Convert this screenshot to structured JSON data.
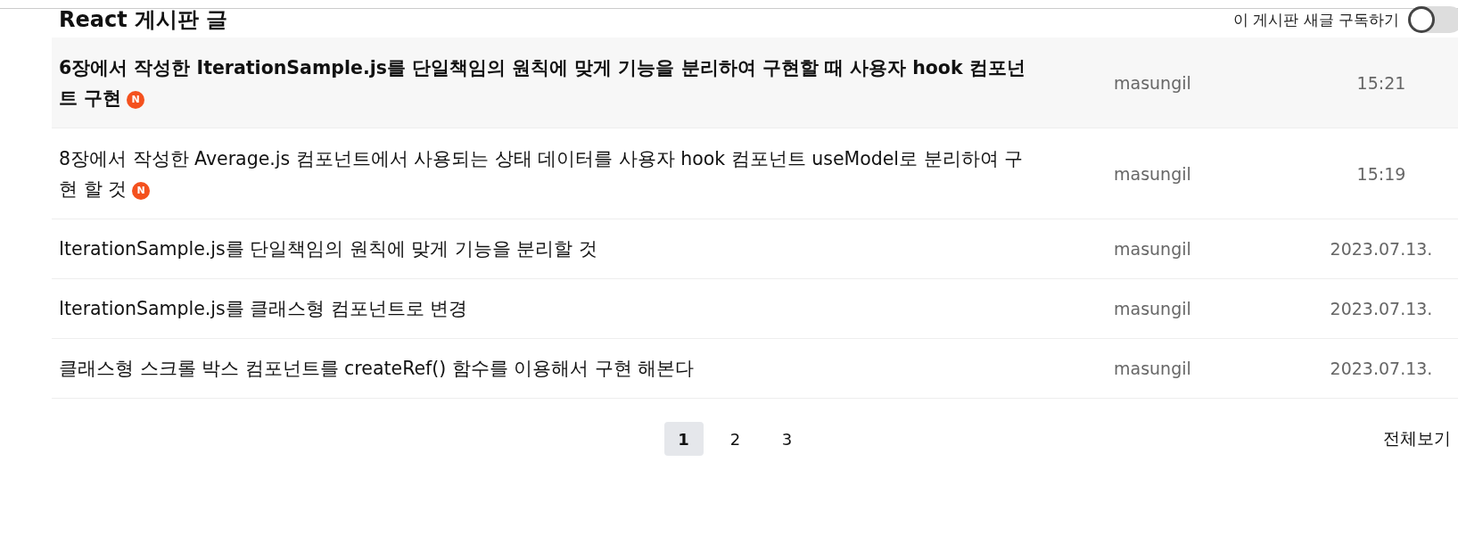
{
  "board": {
    "title": "React 게시판 글",
    "subscribe_label": "이 게시판 새글 구독하기",
    "subscribe_on": false
  },
  "posts": [
    {
      "title": "6장에서 작성한 IterationSample.js를 단일책임의 원칙에 맞게 기능을 분리하여 구현할 때 사용자 hook 컴포넌트 구현",
      "badge": "N",
      "author": "masungil",
      "time": "15:21",
      "emphasized": true
    },
    {
      "title": "8장에서 작성한 Average.js 컴포넌트에서 사용되는 상태 데이터를 사용자 hook 컴포넌트 useModel로 분리하여 구현 할 것",
      "badge": "N",
      "author": "masungil",
      "time": "15:19",
      "emphasized": false
    },
    {
      "title": "IterationSample.js를 단일책임의 원칙에 맞게 기능을 분리할 것",
      "author": "masungil",
      "time": "2023.07.13.",
      "emphasized": false
    },
    {
      "title": "IterationSample.js를 클래스형 컴포넌트로 변경",
      "author": "masungil",
      "time": "2023.07.13.",
      "emphasized": false
    },
    {
      "title": "클래스형 스크롤 박스 컴포넌트를 createRef() 함수를 이용해서 구현 해본다",
      "author": "masungil",
      "time": "2023.07.13.",
      "emphasized": false
    }
  ],
  "pagination": {
    "pages": [
      {
        "label": "1",
        "selected": true
      },
      {
        "label": "2",
        "selected": false
      },
      {
        "label": "3",
        "selected": false
      }
    ],
    "view_all": "전체보기"
  }
}
